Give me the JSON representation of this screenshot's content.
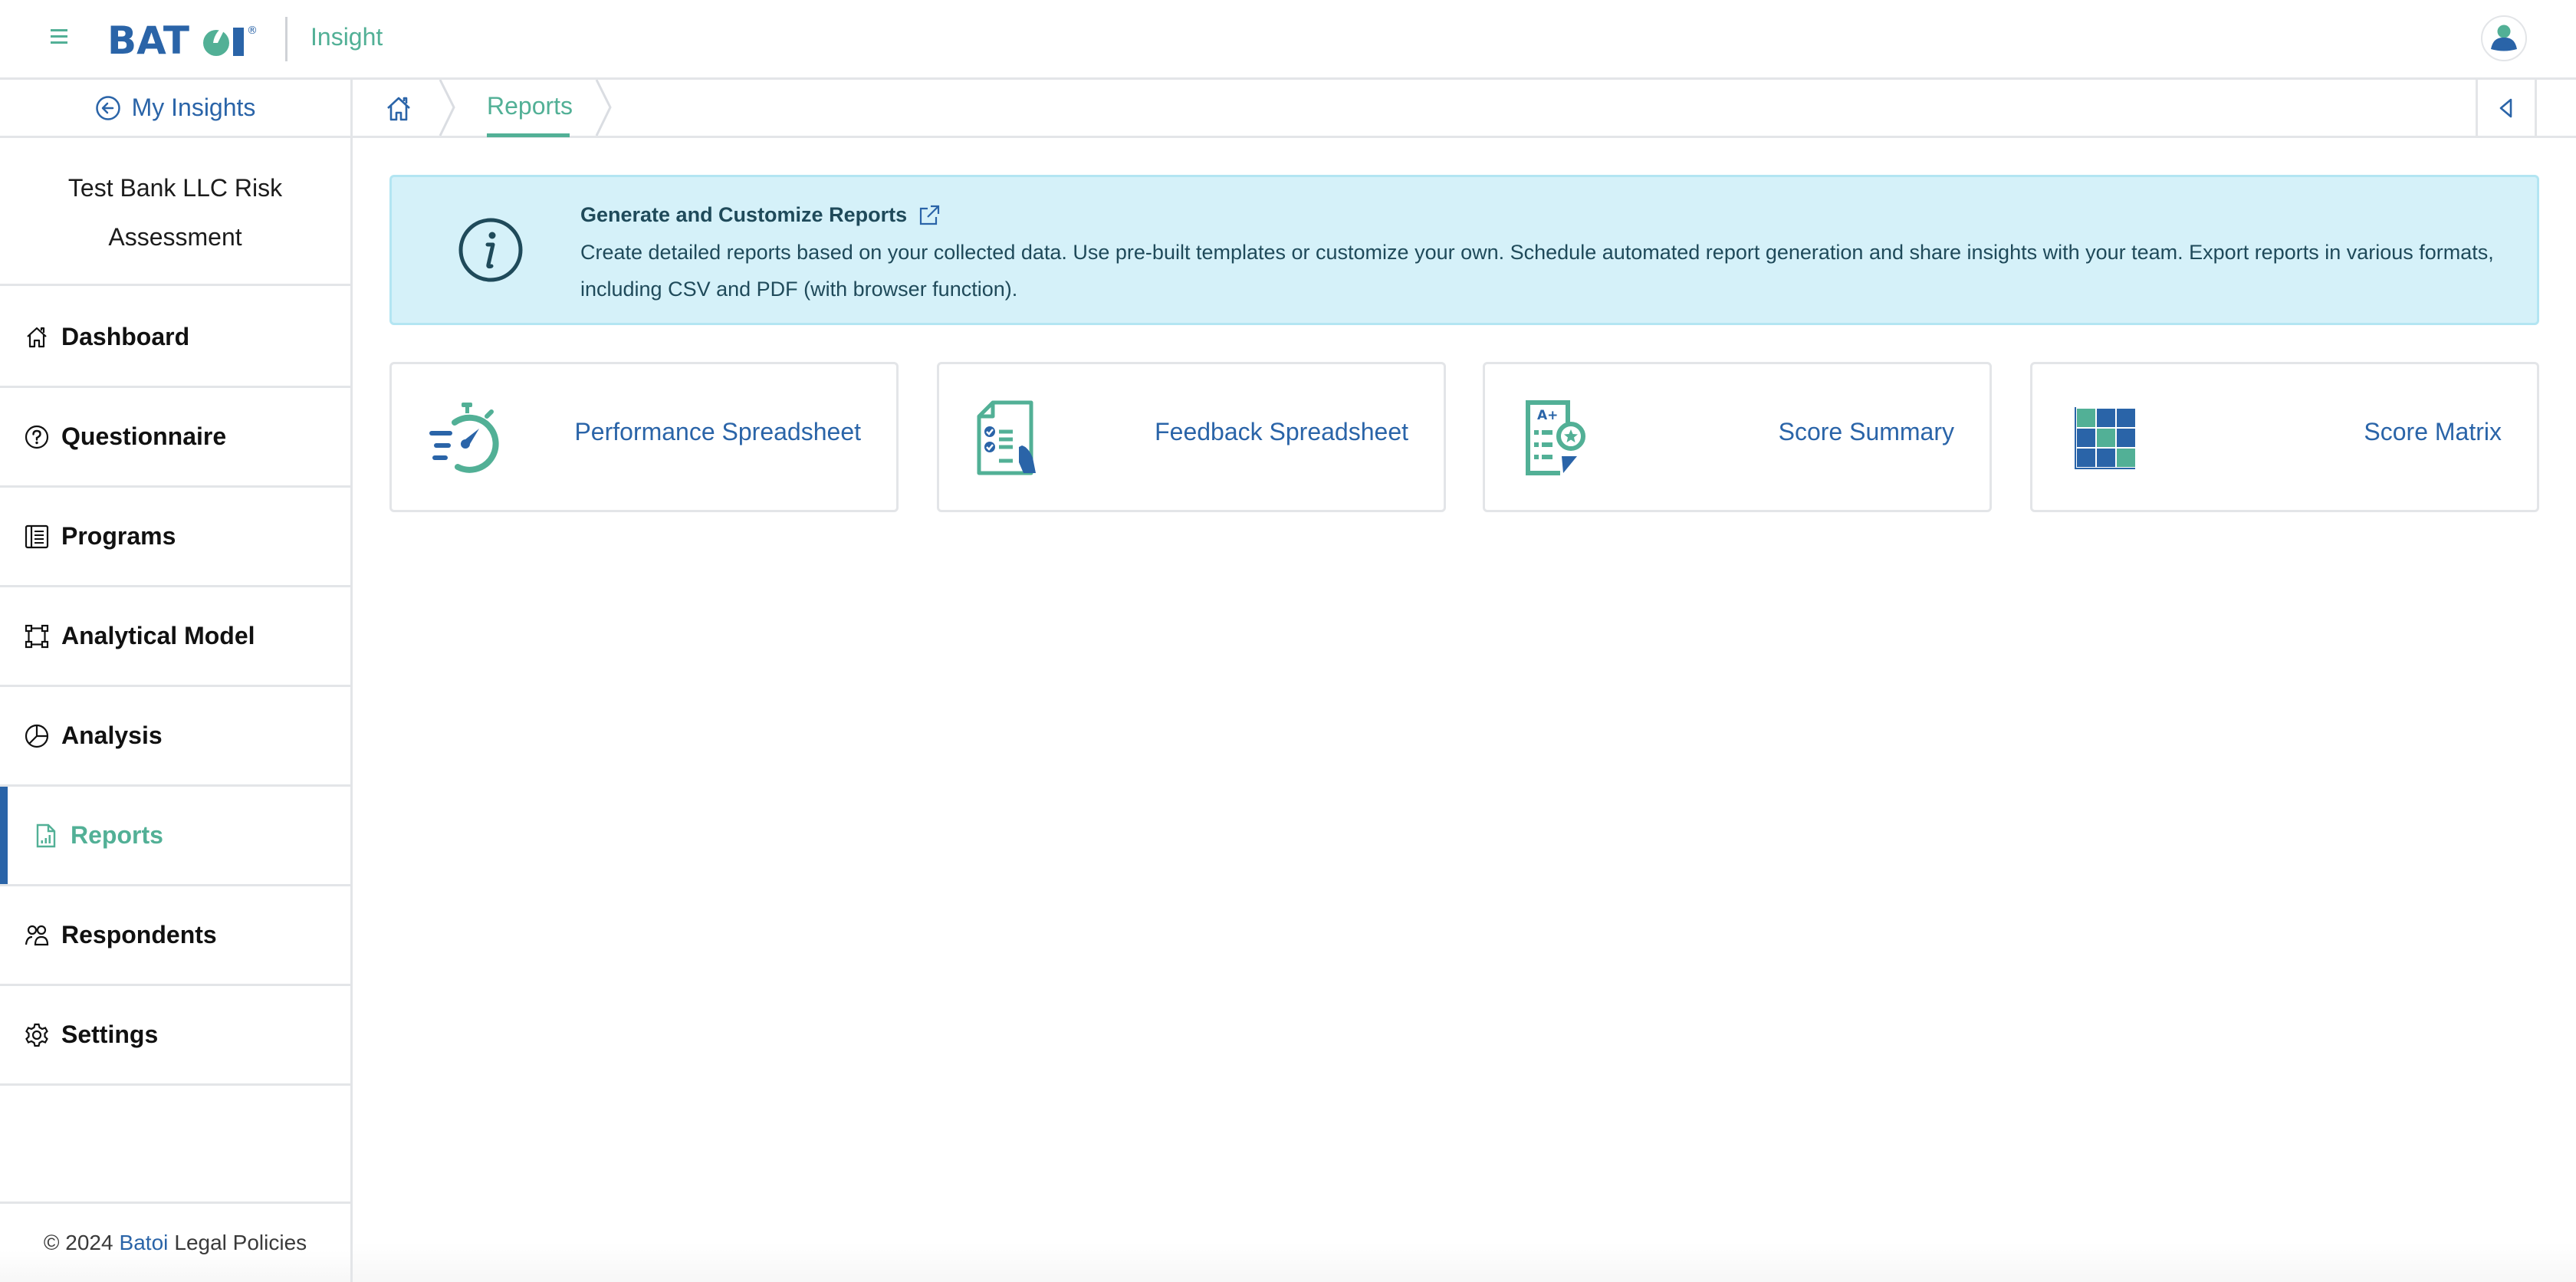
{
  "header": {
    "logo_text": "BATOI",
    "logo_reg": "®",
    "app_name": "Insight",
    "menu_icon": "hamburger-icon",
    "avatar_icon": "user-avatar-icon"
  },
  "sidebar": {
    "back_link": {
      "icon": "arrow-left-circle-icon",
      "label": "My Insights"
    },
    "project_title": "Test Bank LLC Risk Assessment",
    "items": [
      {
        "label": "Dashboard",
        "icon": "home-icon",
        "active": false
      },
      {
        "label": "Questionnaire",
        "icon": "question-circle-icon",
        "active": false
      },
      {
        "label": "Programs",
        "icon": "list-book-icon",
        "active": false
      },
      {
        "label": "Analytical Model",
        "icon": "model-frame-icon",
        "active": false
      },
      {
        "label": "Analysis",
        "icon": "pie-chart-icon",
        "active": false
      },
      {
        "label": "Reports",
        "icon": "report-file-icon",
        "active": true
      },
      {
        "label": "Respondents",
        "icon": "users-icon",
        "active": false
      },
      {
        "label": "Settings",
        "icon": "gear-icon",
        "active": false
      }
    ],
    "footer": {
      "copyright": "© 2024",
      "brand_link": "Batoi",
      "legal_link": "Legal Policies"
    }
  },
  "breadcrumb": {
    "home_icon": "home-icon",
    "items": [
      {
        "label": "Reports",
        "active": true
      }
    ],
    "collapse_icon": "triangle-left-icon"
  },
  "banner": {
    "icon": "info-circle-icon",
    "title": "Generate and Customize Reports",
    "link_icon": "external-link-icon",
    "text": "Create detailed reports based on your collected data. Use pre-built templates or customize your own. Schedule automated report generation and share insights with your team. Export reports in various formats, including CSV and PDF (with browser function)."
  },
  "cards": [
    {
      "label": "Performance Spreadsheet",
      "icon": "stopwatch-icon"
    },
    {
      "label": "Feedback Spreadsheet",
      "icon": "checklist-document-icon"
    },
    {
      "label": "Score Summary",
      "icon": "grade-document-icon"
    },
    {
      "label": "Score Matrix",
      "icon": "matrix-grid-icon"
    }
  ],
  "colors": {
    "brand_blue": "#2a64a8",
    "brand_green": "#52b096",
    "banner_bg": "#d5f1f9",
    "banner_text": "#1f4a5a",
    "border": "#e3e5e8"
  }
}
